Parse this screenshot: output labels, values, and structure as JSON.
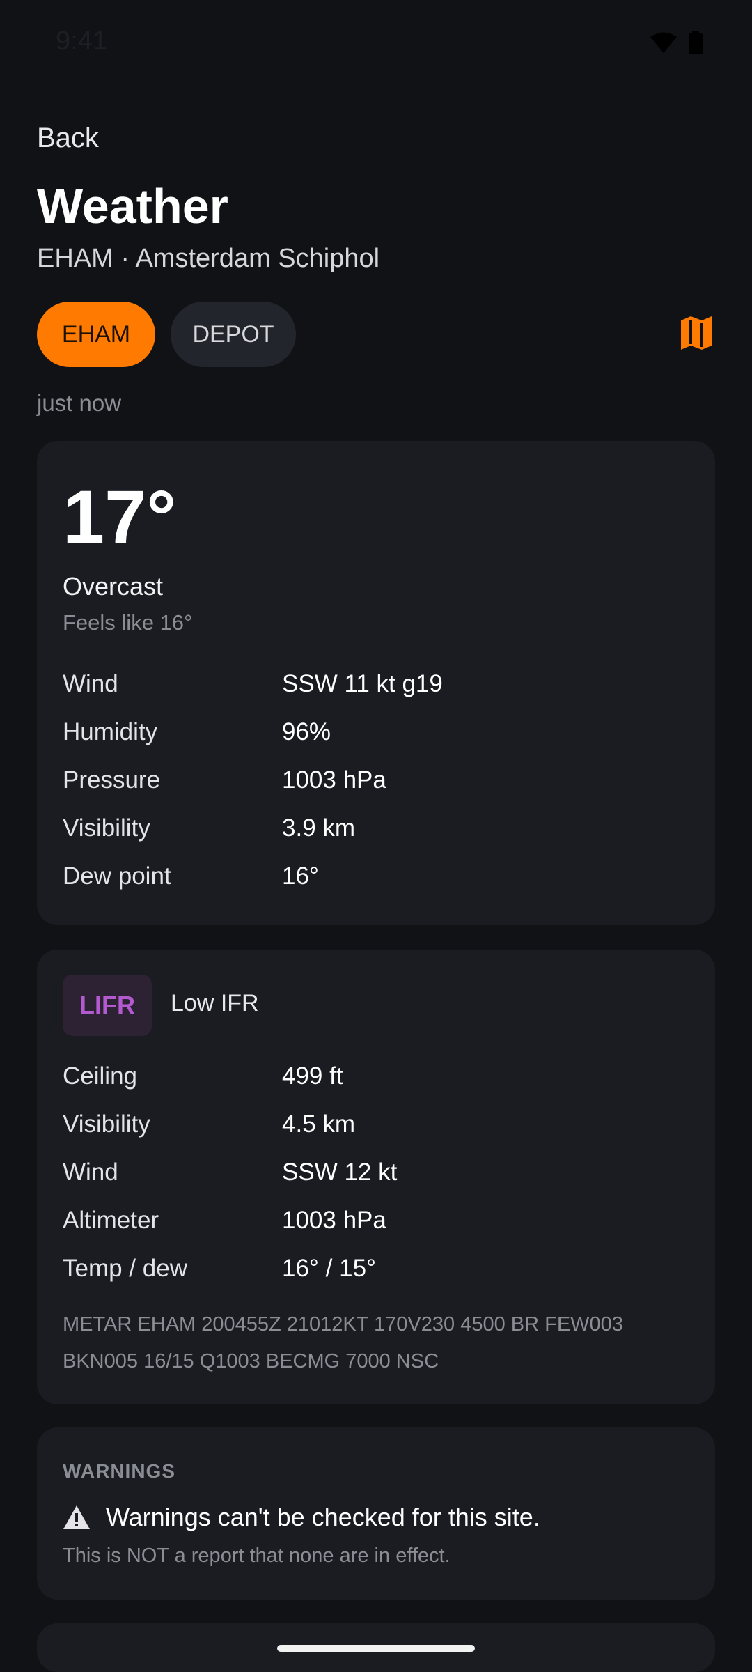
{
  "status_bar": {
    "time": "9:41"
  },
  "header": {
    "back_label": "Back",
    "title": "Weather",
    "subtitle": "EHAM · Amsterdam Schiphol"
  },
  "chips": [
    {
      "label": "EHAM",
      "selected": true
    },
    {
      "label": "DEPOT",
      "selected": false
    }
  ],
  "map_button_icon": "map-icon",
  "updated": "just now",
  "current": {
    "temperature": "17°",
    "condition": "Overcast",
    "feels_like": "Feels like 16°",
    "rows": [
      {
        "label": "Wind",
        "value": "SSW 11 kt g19"
      },
      {
        "label": "Humidity",
        "value": "96%"
      },
      {
        "label": "Pressure",
        "value": "1003 hPa"
      },
      {
        "label": "Visibility",
        "value": "3.9 km"
      },
      {
        "label": "Dew point",
        "value": "16°"
      }
    ]
  },
  "flight_category": {
    "code": "LIFR",
    "label": "Low IFR",
    "rows": [
      {
        "label": "Ceiling",
        "value": "499 ft"
      },
      {
        "label": "Visibility",
        "value": "4.5 km"
      },
      {
        "label": "Wind",
        "value": "SSW 12 kt"
      },
      {
        "label": "Altimeter",
        "value": "1003 hPa"
      },
      {
        "label": "Temp / dew",
        "value": "16° / 15°"
      }
    ],
    "metar": "METAR EHAM 200455Z 21012KT 170V230 4500 BR FEW003 BKN005 16/15 Q1003 BECMG 7000 NSC"
  },
  "warnings": {
    "heading": "WARNINGS",
    "message": "Warnings can't be checked for this site.",
    "note": "This is NOT a report that none are in effect."
  },
  "colors": {
    "accent": "#ff7a00",
    "background": "#111215",
    "card": "#1a1c22",
    "lifr": "#b45ad0"
  }
}
